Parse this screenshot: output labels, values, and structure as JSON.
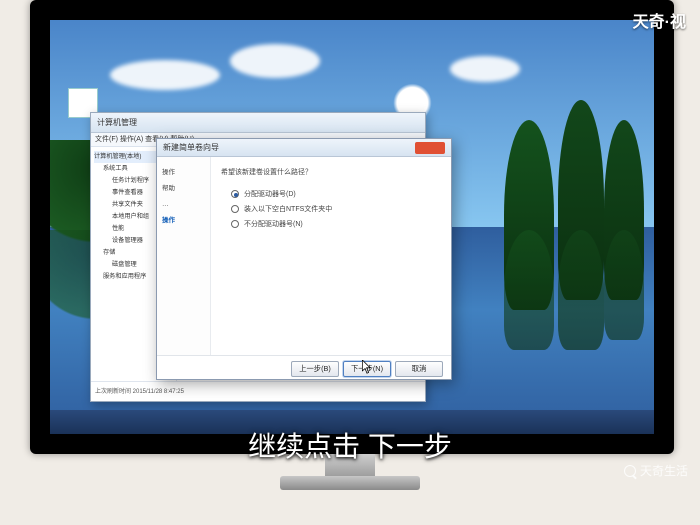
{
  "subtitle": "继续点击 下一步",
  "watermark_top": "天奇·视",
  "watermark_bottom": "天奇生活",
  "mgmt": {
    "title": "计算机管理",
    "menu": "文件(F)  操作(A)  查看(V)  帮助(H)",
    "tree": {
      "root": "计算机管理(本地)",
      "a": "系统工具",
      "a1": "任务计划程序",
      "a2": "事件查看器",
      "a3": "共享文件夹",
      "a4": "本地用户和组",
      "a5": "性能",
      "a6": "设备管理器",
      "b": "存储",
      "b1": "磁盘管理",
      "c": "服务和应用程序"
    },
    "status": "上次刷新时间 2015/11/28 8:47:25"
  },
  "wizard": {
    "title": "新建简单卷向导",
    "side": {
      "s1": "操作",
      "s2": "帮助",
      "s3": "…",
      "s4": "操作"
    },
    "prompt": "希望该新建卷设置什么路径？",
    "options": {
      "o1": "分配驱动器号(D)",
      "o2": "装入以下空白NTFS文件夹中",
      "o3": "不分配驱动器号(N)"
    },
    "buttons": {
      "back": "上一步(B)",
      "next": "下一步(N)",
      "cancel": "取消"
    }
  }
}
